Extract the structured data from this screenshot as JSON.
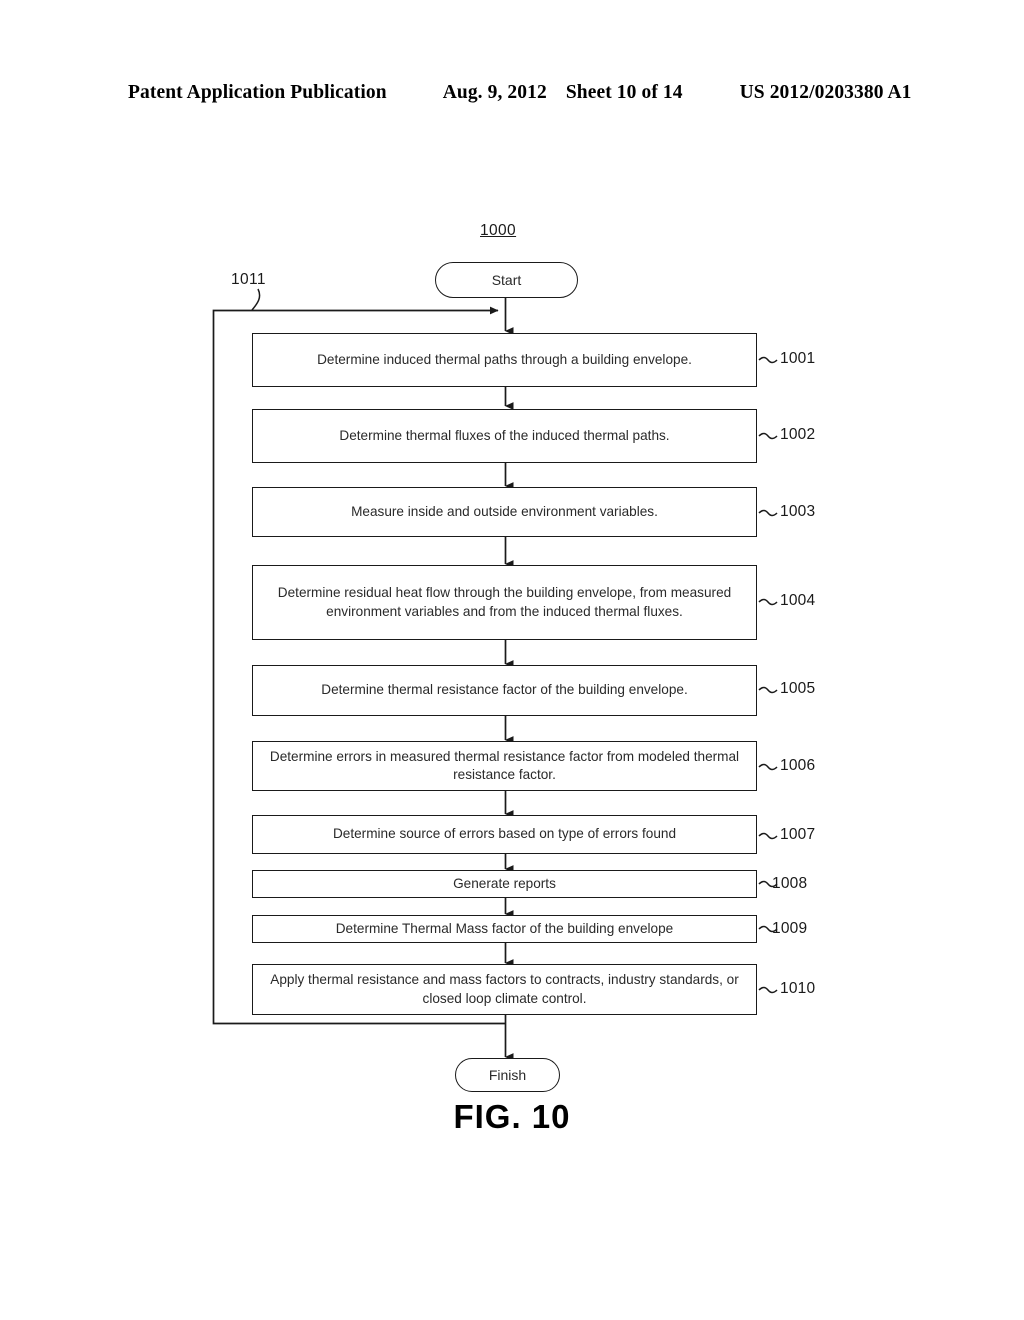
{
  "header": {
    "publication": "Patent Application Publication",
    "date": "Aug. 9, 2012",
    "sheet": "Sheet 10 of 14",
    "number": "US 2012/0203380 A1"
  },
  "figure": {
    "caption": "FIG. 10",
    "diagram_id": "1000",
    "loop_id": "1011",
    "start_label": "Start",
    "finish_label": "Finish",
    "steps": [
      {
        "ref": "1001",
        "text": "Determine induced thermal paths through a building envelope."
      },
      {
        "ref": "1002",
        "text": "Determine thermal fluxes of the induced thermal paths."
      },
      {
        "ref": "1003",
        "text": "Measure inside and outside environment variables."
      },
      {
        "ref": "1004",
        "text": "Determine residual heat flow through the building envelope, from measured environment variables and from the induced thermal fluxes."
      },
      {
        "ref": "1005",
        "text": "Determine thermal resistance factor of the building envelope."
      },
      {
        "ref": "1006",
        "text": "Determine errors in measured thermal resistance factor from modeled thermal resistance factor."
      },
      {
        "ref": "1007",
        "text": "Determine source of errors based on type of errors found"
      },
      {
        "ref": "1008",
        "text": "Generate reports"
      },
      {
        "ref": "1009",
        "text": "Determine Thermal Mass factor of the building envelope"
      },
      {
        "ref": "1010",
        "text": "Apply thermal resistance and mass factors to contracts, industry standards, or closed loop climate control."
      }
    ]
  },
  "colors": {
    "ink": "#1a1a1a",
    "text": "#2a2a2a",
    "background": "#ffffff"
  }
}
